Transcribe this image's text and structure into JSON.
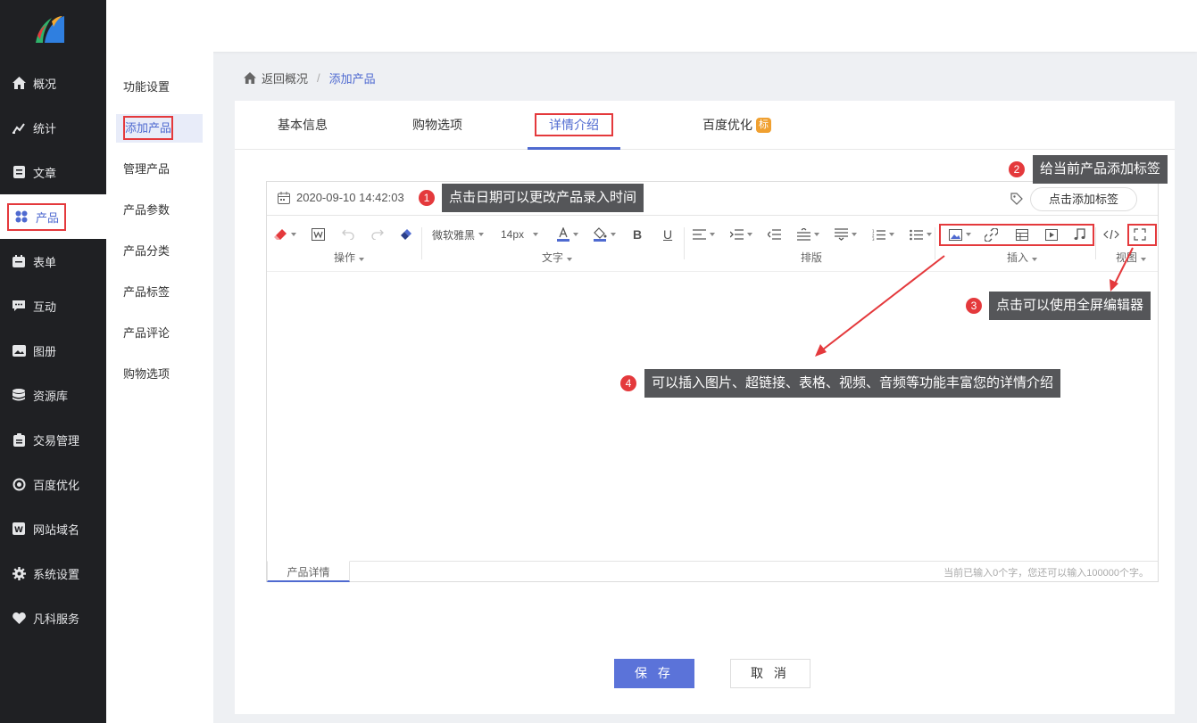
{
  "sidebar": {
    "items": [
      {
        "label": "概况",
        "icon": "home-icon"
      },
      {
        "label": "统计",
        "icon": "chart-icon"
      },
      {
        "label": "文章",
        "icon": "article-icon"
      },
      {
        "label": "产品",
        "icon": "grid-icon"
      },
      {
        "label": "表单",
        "icon": "calendar-icon"
      },
      {
        "label": "互动",
        "icon": "chat-icon"
      },
      {
        "label": "图册",
        "icon": "album-icon"
      },
      {
        "label": "资源库",
        "icon": "database-icon"
      },
      {
        "label": "交易管理",
        "icon": "clipboard-icon"
      },
      {
        "label": "百度优化",
        "icon": "target-icon"
      },
      {
        "label": "网站域名",
        "icon": "w-icon"
      },
      {
        "label": "系统设置",
        "icon": "gear-icon"
      },
      {
        "label": "凡科服务",
        "icon": "heart-icon"
      }
    ],
    "active_index": 3
  },
  "subnav": {
    "items": [
      "功能设置",
      "添加产品",
      "管理产品",
      "产品参数",
      "产品分类",
      "产品标签",
      "产品评论",
      "购物选项"
    ],
    "active_index": 1
  },
  "breadcrumb": {
    "back": "返回概况",
    "current": "添加产品"
  },
  "tabs": {
    "items": [
      "基本信息",
      "购物选项",
      "详情介绍",
      "百度优化"
    ],
    "badge": "标",
    "active_index": 2
  },
  "editor": {
    "date": "2020-09-10 14:42:03",
    "tag_button": "点击添加标签",
    "font_family": "微软雅黑",
    "font_size": "14px",
    "groups": {
      "op": "操作",
      "text": "文字",
      "layout": "排版",
      "insert": "插入",
      "view": "视图"
    },
    "footer_tab": "产品详情",
    "count_text": "当前已输入0个字，您还可以输入100000个字。"
  },
  "annotations": {
    "a1": {
      "num": "1",
      "text": "点击日期可以更改产品录入时间"
    },
    "a2": {
      "num": "2",
      "text": "给当前产品添加标签"
    },
    "a3": {
      "num": "3",
      "text": "点击可以使用全屏编辑器"
    },
    "a4": {
      "num": "4",
      "text": "可以插入图片、超链接、表格、视频、音频等功能丰富您的详情介绍"
    }
  },
  "buttons": {
    "save": "保 存",
    "cancel": "取 消"
  },
  "colors": {
    "accent": "#4f6ad0",
    "sidebar_bg": "#1f2023",
    "highlight": "#e4393c",
    "callout_bg": "#555659"
  }
}
